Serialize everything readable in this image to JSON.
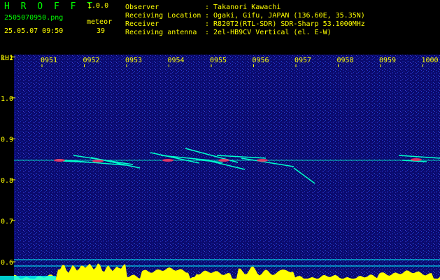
{
  "app": {
    "name": "H R O F F T",
    "version": "1.0.0",
    "filename": "2505070950.png",
    "timestamp": "25.05.07 09:50",
    "meteor_label": "meteor",
    "meteor_count": "39"
  },
  "info": {
    "observer_label": "Observer",
    "observer_value": ": Takanori Kawachi",
    "location_label": "Receiving Location",
    "location_value": ": Ogaki, Gifu, JAPAN (136.60E, 35.35N)",
    "receiver_label": "Receiver",
    "receiver_value": ": R820T2(RTL-SDR) SDR-Sharp 53.1000MHz",
    "antenna_label": "Receiving antenna",
    "antenna_value": ": 2el-HB9CV Vertical (el. E-W)"
  },
  "chart_data": {
    "type": "heatmap",
    "ylabel": "kHz",
    "x_ticks": [
      "0951",
      "0952",
      "0953",
      "0954",
      "0955",
      "0956",
      "0957",
      "0958",
      "0959",
      "1000"
    ],
    "y_ticks": [
      "1.1",
      "1.0",
      "0.9",
      "0.8",
      "0.7",
      "0.6"
    ],
    "y_range": [
      0.6,
      1.15
    ],
    "carrier_khz": 0.9,
    "colors": {
      "background": "#0a0a6e",
      "noise": "#3a4cff",
      "echo": "#00ffcc",
      "hot": "#ff3060",
      "level": "#ffff00",
      "baseline": "#00ffff"
    }
  }
}
